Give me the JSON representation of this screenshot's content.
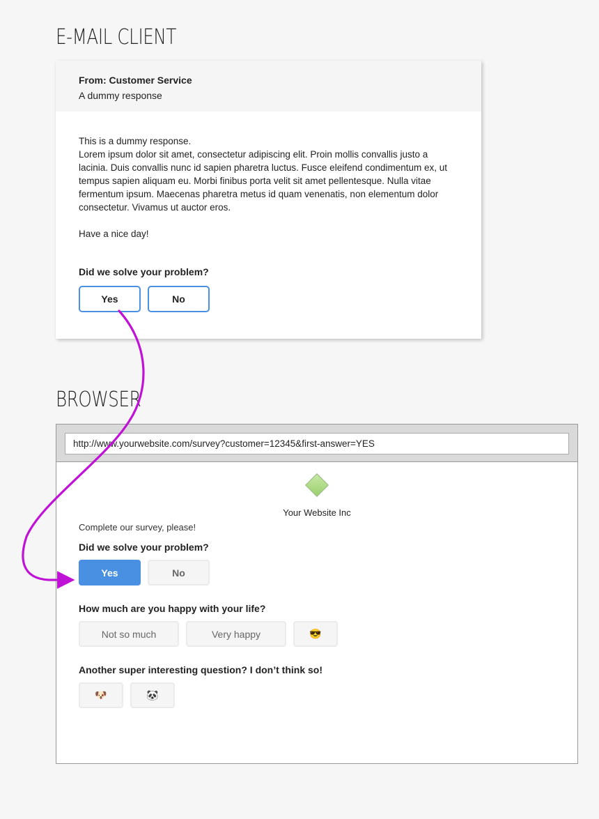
{
  "sections": {
    "email_title": "E-MAIL CLIENT",
    "browser_title": "BROWSER"
  },
  "email": {
    "from": "From: Customer Service",
    "subject": "A dummy response",
    "intro": "This is a dummy response.",
    "body": "Lorem ipsum dolor sit amet, consectetur adipiscing elit. Proin mollis convallis justo a lacinia. Duis convallis nunc id sapien pharetra luctus. Fusce eleifend condimentum ex, ut tempus sapien aliquam eu. Morbi finibus porta velit sit amet pellentesque. Nulla vitae fermentum ipsum. Maecenas pharetra metus id quam venenatis, non elementum dolor consectetur. Vivamus ut auctor eros.",
    "greeting": "Have a nice day!",
    "question": "Did we solve your problem?",
    "buttons": [
      "Yes",
      "No"
    ]
  },
  "browser": {
    "url": "http://www.yourwebsite.com/survey?customer=12345&first-answer=YES",
    "logo_name": "Your Website Inc",
    "intro": "Complete our survey, please!",
    "questions": [
      {
        "text": "Did we solve your problem?",
        "options": [
          "Yes",
          "No"
        ],
        "selected": "Yes"
      },
      {
        "text": "How much are you happy with your life?",
        "options": [
          "Not so much",
          "Very happy",
          "😎"
        ],
        "selected": null
      },
      {
        "text": "Another super interesting question? I don’t think so!",
        "options": [
          "🐶",
          "🐼"
        ],
        "selected": null
      }
    ]
  },
  "colors": {
    "accent": "#4a90e2",
    "arrow": "#c012d6",
    "logo": "#a9d87e"
  }
}
